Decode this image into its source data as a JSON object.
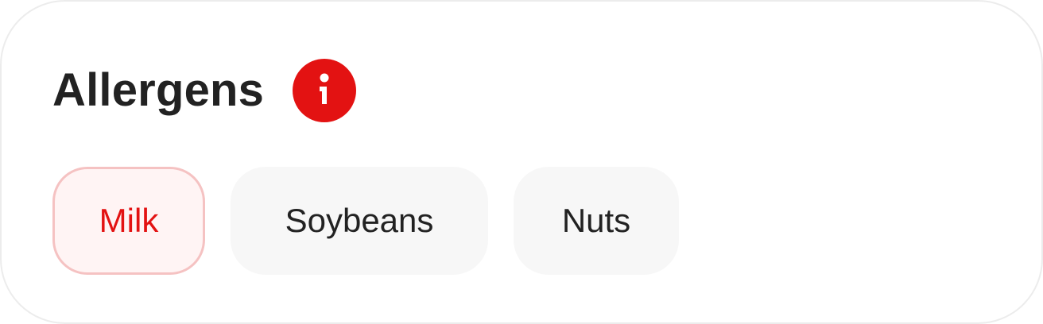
{
  "section": {
    "title": "Allergens",
    "info_icon": "info-icon",
    "accent_color": "#e31212"
  },
  "allergens": [
    {
      "label": "Milk",
      "selected": true
    },
    {
      "label": "Soybeans",
      "selected": false
    },
    {
      "label": "Nuts",
      "selected": false
    }
  ]
}
